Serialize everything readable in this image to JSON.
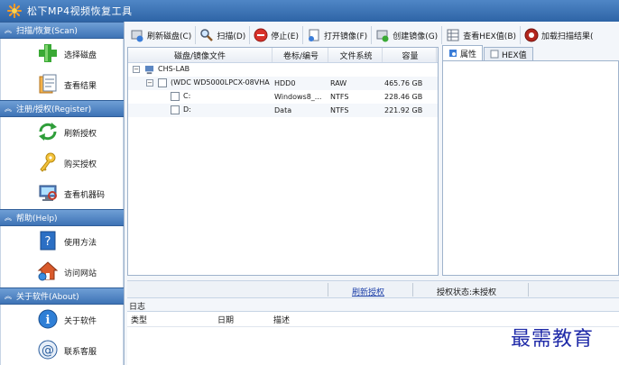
{
  "window": {
    "title": "松下MP4视频恢复工具"
  },
  "sidebar": {
    "sections": [
      {
        "header": "扫描/恢复(Scan)",
        "items": [
          {
            "label": "选择磁盘",
            "icon": "plus-icon"
          },
          {
            "label": "查看结果",
            "icon": "document-icon"
          }
        ]
      },
      {
        "header": "注册/授权(Register)",
        "items": [
          {
            "label": "刷新授权",
            "icon": "refresh-icon"
          },
          {
            "label": "购买授权",
            "icon": "key-icon"
          },
          {
            "label": "查看机器码",
            "icon": "computer-icon"
          }
        ]
      },
      {
        "header": "帮助(Help)",
        "items": [
          {
            "label": "使用方法",
            "icon": "help-icon"
          },
          {
            "label": "访问网站",
            "icon": "home-icon"
          }
        ]
      },
      {
        "header": "关于软件(About)",
        "items": [
          {
            "label": "关于软件",
            "icon": "info-icon"
          },
          {
            "label": "联系客服",
            "icon": "contact-icon"
          }
        ]
      }
    ]
  },
  "toolbar": {
    "refresh_disk": "刷新磁盘(C)",
    "scan": "扫描(D)",
    "stop": "停止(E)",
    "open_image": "打开镜像(F)",
    "create_image": "创建镜像(G)",
    "view_hex": "查看HEX值(B)",
    "load_scan": "加载扫描结果("
  },
  "disk_table": {
    "columns": {
      "name": "磁盘/镜像文件",
      "label": "卷标/编号",
      "fs": "文件系统",
      "size": "容量"
    },
    "rows": [
      {
        "name": "CHS-LAB",
        "label": "",
        "fs": "",
        "size": ""
      },
      {
        "name": "(WDC WD5000LPCX-08VHA",
        "label": "HDD0",
        "fs": "RAW",
        "size": "465.76 GB"
      },
      {
        "name": "C:",
        "label": "Windows8_...",
        "fs": "NTFS",
        "size": "228.46 GB"
      },
      {
        "name": "D:",
        "label": "Data",
        "fs": "NTFS",
        "size": "221.92 GB"
      }
    ]
  },
  "properties": {
    "tab_props": "属性",
    "tab_hex": "HEX值"
  },
  "status": {
    "refresh_link": "刷新授权",
    "auth_status": "授权状态:未授权"
  },
  "log": {
    "title": "日志",
    "columns": {
      "type": "类型",
      "date": "日期",
      "desc": "描述"
    }
  },
  "watermark": "最需教育"
}
